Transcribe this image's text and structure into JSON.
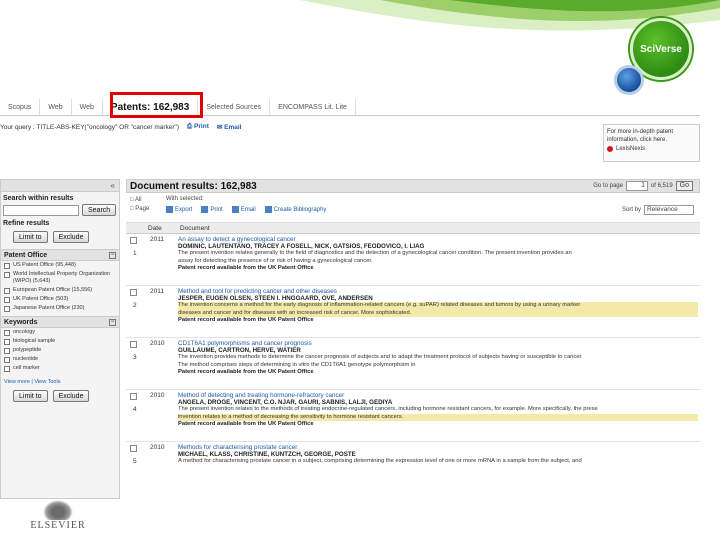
{
  "colors": {
    "accent": "#2e8b13",
    "highlight": "#e00000",
    "link": "#1d5aa8"
  },
  "branding": {
    "sciverse_label": "SciVerse",
    "publisher": "ELSEVIER"
  },
  "tabs": [
    {
      "label": "Scopus"
    },
    {
      "label": "Web"
    },
    {
      "label": "Web"
    },
    {
      "label": "Patents: 162,983"
    },
    {
      "label": "Selected Sources"
    },
    {
      "label": "ENCOMPASS Lit. Lite"
    }
  ],
  "query": {
    "text": "Your query : TITLE-ABS-KEY(\"oncology\" OR \"cancer marker\")",
    "print": "Print",
    "email": "Email"
  },
  "promo": {
    "text": "For more in-depth patent information, click here.",
    "brand": "LexisNexis"
  },
  "left_panel": {
    "search_within": "Search within results",
    "search_button": "Search",
    "refine": "Refine results",
    "limit_button": "Limit to",
    "exclude_button": "Exclude",
    "patent_office_title": "Patent Office",
    "patent_offices": [
      "US Patent Office (95,448)",
      "World Intellectual Property Organization (WIPO) (5,643)",
      "European Patent Office (15,556)",
      "UK Patent Office (503)",
      "Japanese Patent Office (230)"
    ],
    "keywords_title": "Keywords",
    "keywords": [
      "oncology",
      "biological sample",
      "polypeptide",
      "nucleotide",
      "cell marker"
    ],
    "view_more": "View more | View Tools",
    "limit_button_2": "Limit to",
    "exclude_button_2": "Exclude"
  },
  "results": {
    "title": "Document results: 162,983",
    "pager_label": "Go to page",
    "pager_value": "1",
    "pager_of": "of 6,519",
    "go_button": "Go",
    "all_label": "All",
    "page_label": "Page",
    "with_selected": "With selected:",
    "actions": [
      "Export",
      "Print",
      "Email",
      "Create Bibliography"
    ],
    "sort_label": "Sort by",
    "sort_value": "Relevance",
    "col_date": "Date",
    "col_document": "Document",
    "items": [
      {
        "num": "1",
        "year": "2011",
        "title": "An assay to detect a gynecological cancer",
        "authors": "DOMINIC, LAUTENTANO, TRACEY A FOSELL, NICK, GATSIOS, FEODOVICO, I. LIAG",
        "abstract": "The present invention relates generally to the field of diagnostics and the detection of a gynecological cancer condition. The present invention provides an",
        "abstract2": "assay for detecting the presence of or risk of having a gynecological cancer.",
        "source": "Patent record available from the UK Patent Office"
      },
      {
        "num": "2",
        "year": "2011",
        "title": "Method and tool for predicting cancer and other diseases",
        "authors": "JESPER, EUGEN OLSEN, STEEN I. HNGGAARD, OVE, ANDERSEN",
        "abstract": "The invention concerns a method for the early diagnosis of inflammation-related cancers (e.g. suPAR) related diseases and tumors by using a urinary marker",
        "abstract2": "diseases and cancer and for diseases with an increased risk of cancer. More sophisticated.",
        "source": "Patent record available from the UK Patent Office"
      },
      {
        "num": "3",
        "year": "2010",
        "title": "CD1T6A1 polymorphisms and cancer prognosis",
        "authors": "GUILLAUME, CARTRON, HERVE, WATIER",
        "abstract": "The invention provides methods to determine the cancer prognosis of subjects and to adapt the treatment protocol of subjects having or susceptible to cancer.",
        "abstract2": "The method comprises steps of determining in vitro the CD1T6A1 genotype polymorphism in",
        "source": "Patent record available from the UK Patent Office"
      },
      {
        "num": "4",
        "year": "2010",
        "title": "Method of detecting and treating hormone-refractory cancer",
        "authors": "ANGELA, DROGE, VINCENT, C.O. NJAR, GAURI, SABNIS, LALJI, GEDIYA",
        "abstract": "The present invention relates to the methods of treating endocrine-regulated cancers, including hormone resistant cancers, for example. More specifically, the prese",
        "abstract2": "invention relates to a method of decreasing the sensitivity to hormone resistant cancers.",
        "source": "Patent record available from the UK Patent Office"
      },
      {
        "num": "5",
        "year": "2010",
        "title": "Methods for characterising prostate cancer",
        "authors": "MICHAEL, KLASS, CHRISTINE, KUNTZCH, GEORGE, POSTE",
        "abstract": "A method for characterising prostate cancer in a subject, comprising determining the expression level of one or more mRNA in a sample from the subject, and",
        "abstract2": "",
        "source": ""
      }
    ]
  }
}
